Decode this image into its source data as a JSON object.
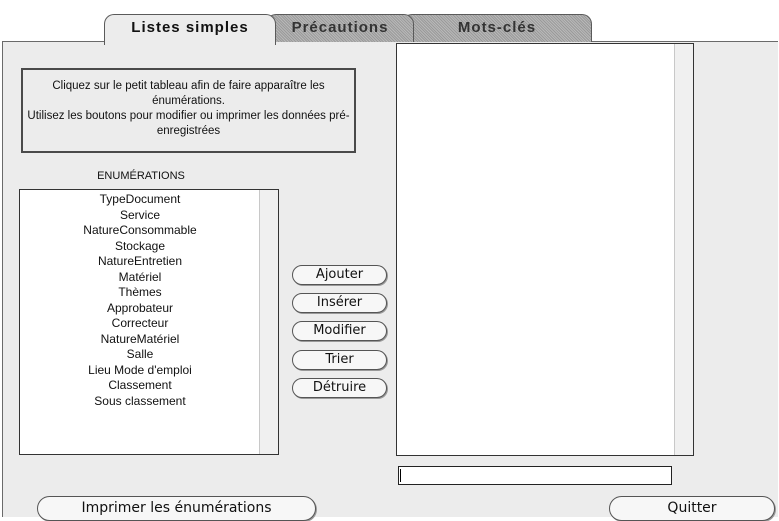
{
  "tabs": [
    {
      "label": "Listes simples",
      "active": true
    },
    {
      "label": "Précautions",
      "active": false
    },
    {
      "label": "Mots-clés",
      "active": false
    }
  ],
  "info": {
    "text": "Cliquez sur le petit tableau afin de faire apparaître les énumérations.\nUtilisez les boutons pour modifier ou imprimer les données pré-enregistrées"
  },
  "enumerations": {
    "label": "ENUMÉRATIONS",
    "items": [
      "TypeDocument",
      "Service",
      "NatureConsommable",
      "Stockage",
      "NatureEntretien",
      "Matériel",
      "Thèmes",
      "Approbateur",
      "Correcteur",
      "NatureMatériel",
      "Salle",
      "Lieu Mode d'emploi",
      "Classement",
      "Sous classement"
    ]
  },
  "actions": {
    "ajouter": "Ajouter",
    "inserer": "Insérer",
    "modifier": "Modifier",
    "trier": "Trier",
    "detruire": "Détruire"
  },
  "value_field": {
    "value": ""
  },
  "footer": {
    "print": "Imprimer les énumérations",
    "quit": "Quitter"
  }
}
